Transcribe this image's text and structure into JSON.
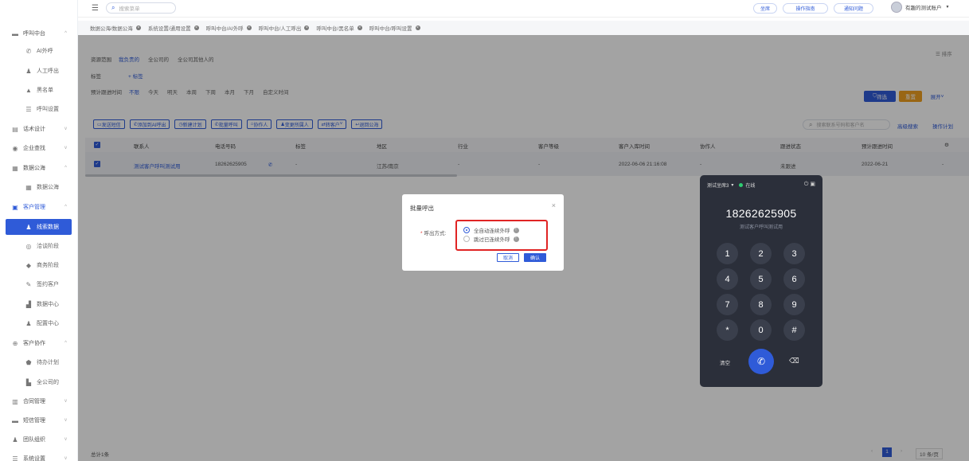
{
  "sidebar": {
    "groups": [
      {
        "label": "呼叫中台",
        "icon": "monitor-icon",
        "children": [
          {
            "label": "AI外呼",
            "icon": "phone-icon"
          },
          {
            "label": "人工呼出",
            "icon": "person-icon"
          },
          {
            "label": "黑名单",
            "icon": "warning-icon"
          },
          {
            "label": "呼叫设置",
            "icon": "settings-icon"
          }
        ]
      },
      {
        "label": "话术设计",
        "icon": "book-icon",
        "children": []
      },
      {
        "label": "企业查找",
        "icon": "globe-icon",
        "children": []
      },
      {
        "label": "数据公海",
        "icon": "database-icon",
        "children": [
          {
            "label": "数据公海",
            "icon": "database-icon"
          }
        ]
      },
      {
        "label": "客户管理",
        "icon": "customer-icon",
        "children": [
          {
            "label": "线索数据",
            "icon": "person-icon"
          },
          {
            "label": "洽谈阶段",
            "icon": "stage-icon"
          },
          {
            "label": "商务阶段",
            "icon": "diamond-icon"
          },
          {
            "label": "签约客户",
            "icon": "sign-icon"
          },
          {
            "label": "数据中心",
            "icon": "chart-icon"
          },
          {
            "label": "配置中心",
            "icon": "config-icon"
          }
        ]
      },
      {
        "label": "客户协作",
        "icon": "coop-icon",
        "children": [
          {
            "label": "待办计划",
            "icon": "shield-icon"
          },
          {
            "label": "全公司的",
            "icon": "bars-icon"
          }
        ]
      },
      {
        "label": "合同管理",
        "icon": "contract-icon",
        "children": []
      },
      {
        "label": "短信管理",
        "icon": "sms-icon",
        "children": []
      },
      {
        "label": "团队组织",
        "icon": "team-icon",
        "children": []
      },
      {
        "label": "系统设置",
        "icon": "system-icon",
        "children": []
      }
    ]
  },
  "topbar": {
    "search_placeholder": "搜索菜单",
    "btn_service": "坐席",
    "btn_guide": "操作指南",
    "btn_notice": "通知问题",
    "user_name": "有趣的测试账户"
  },
  "tabs": [
    "数据公海/数据公海",
    "系统设置/通用设置",
    "呼叫中台/AI外呼",
    "呼叫中台/人工呼出",
    "呼叫中台/黑名单",
    "呼叫中台/呼叫设置"
  ],
  "filters": {
    "scope_label": "资源范围",
    "scope_options": [
      "我负责的",
      "全公司的",
      "全公司其他人的"
    ],
    "tag_label": "标签",
    "tag_add": "+ 标签",
    "time_label": "预计跟进时间",
    "time_options": [
      "不限",
      "今天",
      "明天",
      "本周",
      "下周",
      "本月",
      "下月",
      "自定义时间"
    ],
    "sort_label": "排序",
    "btn_filter": "筛选",
    "btn_reset": "重置",
    "btn_expand": "展开"
  },
  "toolbar": {
    "actions": [
      "发送短信",
      "添加到AI呼出",
      "新建计划",
      "批量呼叫",
      "协作人",
      "变更所属人",
      "转客户",
      "退回公海"
    ],
    "search_placeholder": "搜索联系号码和客户名",
    "link_advanced": "高级搜索",
    "link_plan": "操作计划"
  },
  "table": {
    "headers": [
      "联系人",
      "电话号码",
      "标签",
      "地区",
      "行业",
      "客户等级",
      "客户入库时间",
      "协作人",
      "跟进状态",
      "预计跟进时间"
    ],
    "rows": [
      {
        "contact": "测试客户呼叫测试用",
        "phone": "18262625905",
        "tag": "-",
        "region": "江苏/南京",
        "industry": "-",
        "level": "-",
        "entry_time": "2022-06-06 21:16:08",
        "collab": "-",
        "status": "未跟进",
        "next_time": "2022-06-21",
        "extra": "-"
      }
    ]
  },
  "dialog": {
    "title": "批量呼出",
    "field_label": "呼出方式:",
    "options": [
      "全自动连续外呼",
      "跳过已连续外呼"
    ],
    "selected_index": 0,
    "btn_cancel": "取消",
    "btn_confirm": "确认"
  },
  "dialer": {
    "agent": "测试坐席3",
    "status": "在线",
    "number": "18262625905",
    "contact": "测试客户呼叫测试用",
    "keys": [
      "1",
      "2",
      "3",
      "4",
      "5",
      "6",
      "7",
      "8",
      "9",
      "*",
      "0",
      "#"
    ],
    "clear_label": "清空"
  },
  "footer": {
    "total": "总计1条",
    "page": "1",
    "per_page": "10 条/页"
  },
  "colors": {
    "accent": "#2f5bd8",
    "warning": "#f0a020",
    "highlight": "#e02424",
    "dialer_bg": "#2b2f3a"
  }
}
